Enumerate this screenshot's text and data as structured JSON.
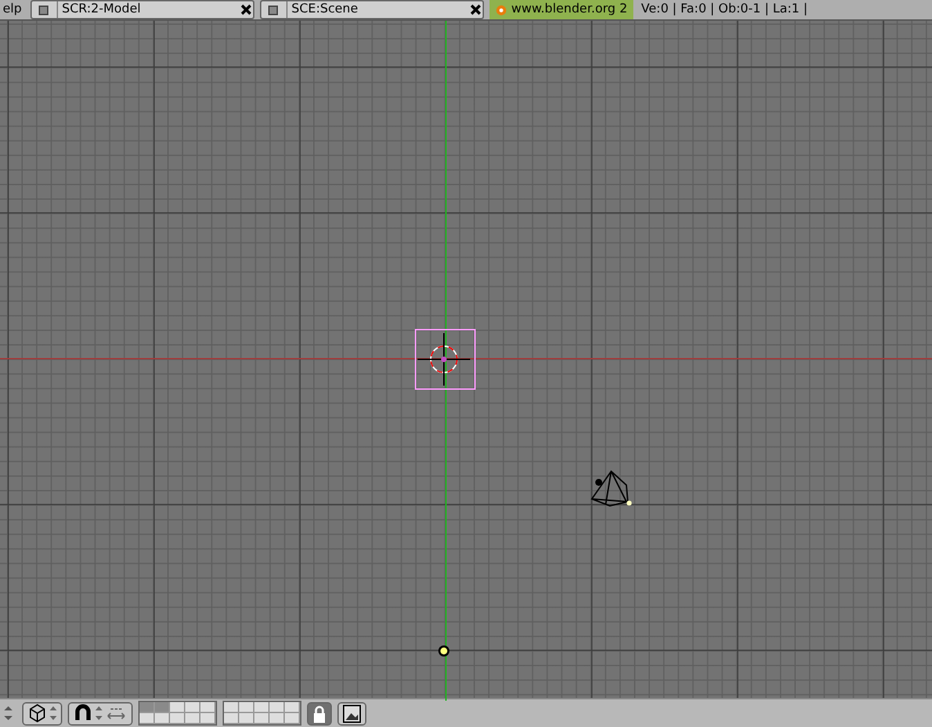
{
  "top_bar": {
    "menu_fragment": "elp",
    "screen_field": "SCR:2-Model",
    "scene_field": "SCE:Scene",
    "website": "www.blender.org 2",
    "stats": "Ve:0 | Fa:0 | Ob:0-1 | La:1 | "
  },
  "toolbar": {
    "layers": [
      {
        "selected": true
      },
      {
        "selected": true
      },
      {
        "selected": false
      },
      {
        "selected": false
      },
      {
        "selected": false
      },
      {
        "selected": false
      },
      {
        "selected": false
      },
      {
        "selected": false
      },
      {
        "selected": false
      },
      {
        "selected": false
      },
      {
        "selected": false
      },
      {
        "selected": false
      },
      {
        "selected": false
      },
      {
        "selected": false
      },
      {
        "selected": false
      },
      {
        "selected": false
      },
      {
        "selected": false
      },
      {
        "selected": false
      },
      {
        "selected": false
      },
      {
        "selected": false
      }
    ],
    "lock": {
      "on": true
    }
  }
}
